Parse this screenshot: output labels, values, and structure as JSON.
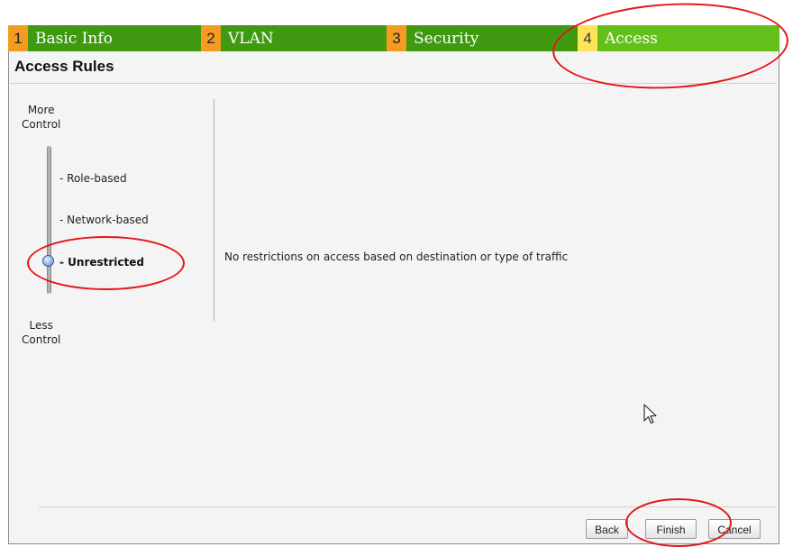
{
  "wizard": {
    "tabs": [
      {
        "num": "1",
        "label": "Basic Info"
      },
      {
        "num": "2",
        "label": "VLAN"
      },
      {
        "num": "3",
        "label": "Security"
      },
      {
        "num": "4",
        "label": "Access"
      }
    ],
    "active_tab": "Access"
  },
  "section": {
    "title": "Access Rules"
  },
  "slider": {
    "top_label_1": "More",
    "top_label_2": "Control",
    "bottom_label_1": "Less",
    "bottom_label_2": "Control",
    "options": [
      "- Role-based",
      "- Network-based",
      "- Unrestricted"
    ],
    "selected": "- Unrestricted"
  },
  "description": "No restrictions on access based on destination or type of traffic",
  "buttons": {
    "back": "Back",
    "finish": "Finish",
    "cancel": "Cancel"
  },
  "colors": {
    "tab_bg": "#3f9a12",
    "tab_active": "#63c01b",
    "tab_num": "#f49b22",
    "tab_num_active": "#ffe45a",
    "highlight": "#e3161b"
  }
}
